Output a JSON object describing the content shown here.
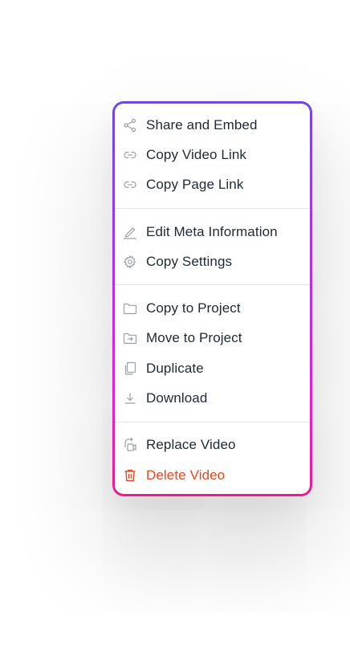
{
  "menu": {
    "groups": [
      {
        "items": [
          {
            "label": "Share and Embed",
            "icon": "share-icon"
          },
          {
            "label": "Copy Video Link",
            "icon": "link-icon"
          },
          {
            "label": "Copy Page Link",
            "icon": "link-icon"
          }
        ]
      },
      {
        "items": [
          {
            "label": "Edit Meta Information",
            "icon": "pencil-icon"
          },
          {
            "label": "Copy Settings",
            "icon": "gear-icon"
          }
        ]
      },
      {
        "items": [
          {
            "label": "Copy to Project",
            "icon": "folder-icon"
          },
          {
            "label": "Move to Project",
            "icon": "folder-move-icon"
          },
          {
            "label": "Duplicate",
            "icon": "duplicate-icon"
          },
          {
            "label": "Download",
            "icon": "download-icon"
          }
        ]
      },
      {
        "items": [
          {
            "label": "Replace Video",
            "icon": "replace-video-icon"
          },
          {
            "label": "Delete Video",
            "icon": "trash-icon"
          }
        ]
      }
    ]
  },
  "colors": {
    "text": "#1f2937",
    "icon": "#9aa0a6",
    "danger": "#f0441a",
    "border_gradient": [
      "#6f4ae0",
      "#ef1a8a"
    ]
  }
}
